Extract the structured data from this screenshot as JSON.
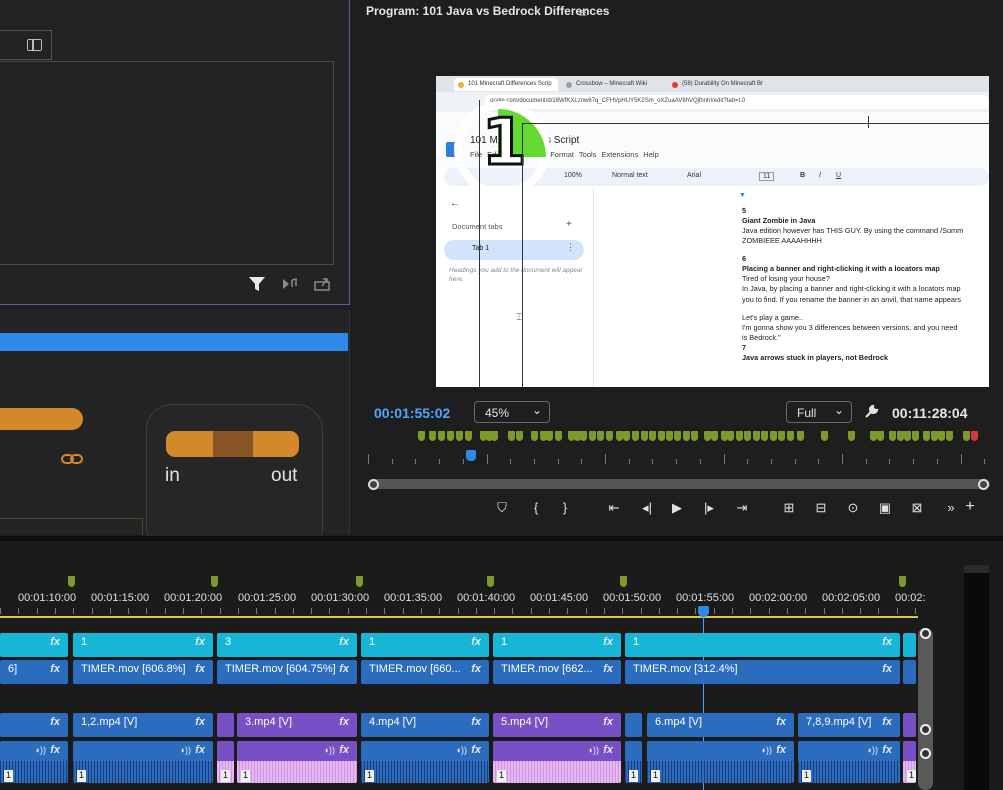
{
  "program": {
    "title": "Program: 101 Java vs Bedrock Differences",
    "menu_icon": "≡",
    "current_timecode": "00:01:55:02",
    "zoom": "45%",
    "quality": "Full",
    "duration_timecode": "00:11:28:04"
  },
  "effects": {
    "in_label": "in",
    "out_label": "out"
  },
  "video": {
    "browser_tabs": [
      {
        "label": "101 Minecraft Differences Scrip",
        "color": "#f2b02e"
      },
      {
        "label": "Crossbow – Minecraft Wiki",
        "color": "#9aa0a6"
      },
      {
        "label": "(58) Durability On Minecraft Br",
        "color": "#e53935"
      }
    ],
    "url": "oogle.com/document/d/16WfKXLznw67q_CFHVpHUY5K2Sm_oXZuaAV8hVQjlhnhI/edit?tab=t.0",
    "doc_title": "101 M      Differences Script",
    "doc_menu": "File   Edit   View   Insert   Format   Tools   Extensions   Help",
    "toolbar": {
      "zoom": "100%",
      "style": "Normal text",
      "font": "Arial",
      "size": "11",
      "bold": "B",
      "italic": "I",
      "underline": "U"
    },
    "sidebar": {
      "back": "←",
      "heading": "Document tabs",
      "plus": "+",
      "tab1": "Tab 1",
      "tab_menu": "⋮",
      "placeholder": "Headings you add to the document will appear here."
    },
    "timer_digit": "1",
    "page_lines": [
      {
        "text": "5",
        "bold": true
      },
      {
        "text": "Giant Zombie in Java",
        "bold": true
      },
      {
        "text": "Java edition however has THIS GUY. By using the command /Summ",
        "bold": false
      },
      {
        "text": "ZOMBIEEE AAAAHHHH",
        "bold": false
      },
      {
        "text": "",
        "bold": false
      },
      {
        "text": "6",
        "bold": true
      },
      {
        "text": "Placing a banner and right-clicking it with a locators map",
        "bold": true
      },
      {
        "text": "Tired of losing your house?",
        "bold": false
      },
      {
        "text": "In Java, by placing a banner and right-clicking it with a locators map",
        "bold": false
      },
      {
        "text": "you to find. If you rename the banner in an anvil, that name appears",
        "bold": false
      },
      {
        "text": "",
        "bold": false
      },
      {
        "text": "Let's play a game..",
        "bold": false
      },
      {
        "text": "I'm gonna show you 3 differences between versions, and you need",
        "bold": false
      },
      {
        "text": "is Bedrock.\"",
        "bold": false
      },
      {
        "text": "7",
        "bold": true
      },
      {
        "text": "Java arrows stuck in players, not Bedrock",
        "bold": true
      }
    ]
  },
  "timeline": {
    "timecodes": [
      "00:01:10:00",
      "00:01:15:00",
      "00:01:20:00",
      "00:01:25:00",
      "00:01:30:00",
      "00:01:35:00",
      "00:01:40:00",
      "00:01:45:00",
      "00:01:50:00",
      "00:01:55:00",
      "00:02:00:00",
      "00:02:05:00",
      "00:02:"
    ],
    "v3_clips": [
      {
        "label": "",
        "fx": "fx"
      },
      {
        "label": "1",
        "fx": "fx"
      },
      {
        "label": "3",
        "fx": "fx"
      },
      {
        "label": "1",
        "fx": "fx"
      },
      {
        "label": "1",
        "fx": "fx"
      },
      {
        "label": "1",
        "fx": "fx"
      }
    ],
    "v2_clips": [
      {
        "label": "6]",
        "fx": "fx"
      },
      {
        "label": "TIMER.mov [606.8%]",
        "fx": "fx"
      },
      {
        "label": "TIMER.mov [604.75%]",
        "fx": "fx"
      },
      {
        "label": "TIMER.mov [660...",
        "fx": "fx"
      },
      {
        "label": "TIMER.mov [662...",
        "fx": "fx"
      },
      {
        "label": "TIMER.mov [312.4%]",
        "fx": "fx"
      }
    ],
    "v1_clips": [
      {
        "label": "",
        "fx": "fx"
      },
      {
        "label": "1,2.mp4 [V]",
        "fx": "fx"
      },
      {
        "label": "",
        "fx": ""
      },
      {
        "label": "3.mp4 [V]",
        "fx": "fx"
      },
      {
        "label": "4.mp4 [V]",
        "fx": "fx"
      },
      {
        "label": "5.mp4 [V]",
        "fx": "fx"
      },
      {
        "label": "",
        "fx": ""
      },
      {
        "label": "6.mp4 [V]",
        "fx": "fx"
      },
      {
        "label": "7,8,9.mp4 [V]",
        "fx": "fx"
      }
    ],
    "audio_clip_number": "1",
    "audio_fx": "fx"
  },
  "icons": {
    "panel_toggle": "panel-toggle-icon",
    "filter": "filter-icon",
    "export_frame": "export-icon",
    "link": "link-icon",
    "wrench": "wrench-icon"
  },
  "colors": {
    "accent_blue": "#2d8ae8",
    "timecode_blue": "#4ea6ff",
    "clip_cyan": "#17b6d6",
    "clip_blue": "#2c6cbf",
    "clip_purple": "#7650c4",
    "marker_green": "#7d9a2b",
    "orange": "#d3882b"
  }
}
